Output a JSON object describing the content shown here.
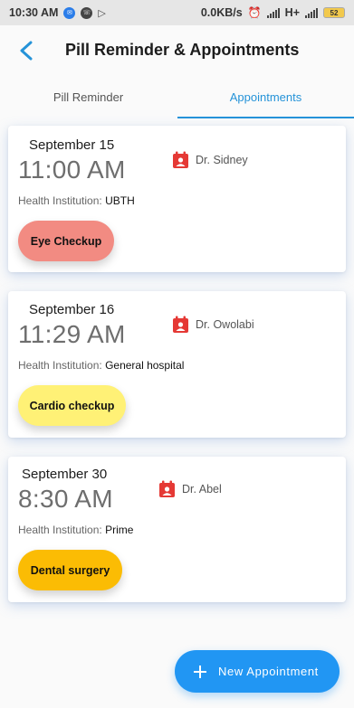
{
  "status_bar": {
    "time": "10:30 AM",
    "net_speed": "0.0KB/s",
    "network": "H+",
    "battery": "52"
  },
  "header": {
    "title": "Pill Reminder & Appointments"
  },
  "tabs": [
    {
      "label": "Pill Reminder",
      "active": false
    },
    {
      "label": "Appointments",
      "active": true
    }
  ],
  "accent_color": "#2593d8",
  "appointments": [
    {
      "date": "September 15",
      "time": "11:00 AM",
      "doctor": "Dr. Sidney",
      "institution_label": "Health Institution: ",
      "institution": "UBTH",
      "type": "Eye Checkup",
      "chip_color": "#f28b82"
    },
    {
      "date": "September 16",
      "time": "11:29 AM",
      "doctor": "Dr. Owolabi",
      "institution_label": "Health Institution: ",
      "institution": "General hospital",
      "type": "Cardio checkup",
      "chip_color": "#fff176"
    },
    {
      "date": "September 30",
      "time": "8:30 AM",
      "doctor": "Dr. Abel",
      "institution_label": "Health Institution: ",
      "institution": "Prime",
      "type": "Dental surgery",
      "chip_color": "#fbbc04"
    }
  ],
  "fab": {
    "label": "New Appointment",
    "icon": "plus-icon"
  }
}
